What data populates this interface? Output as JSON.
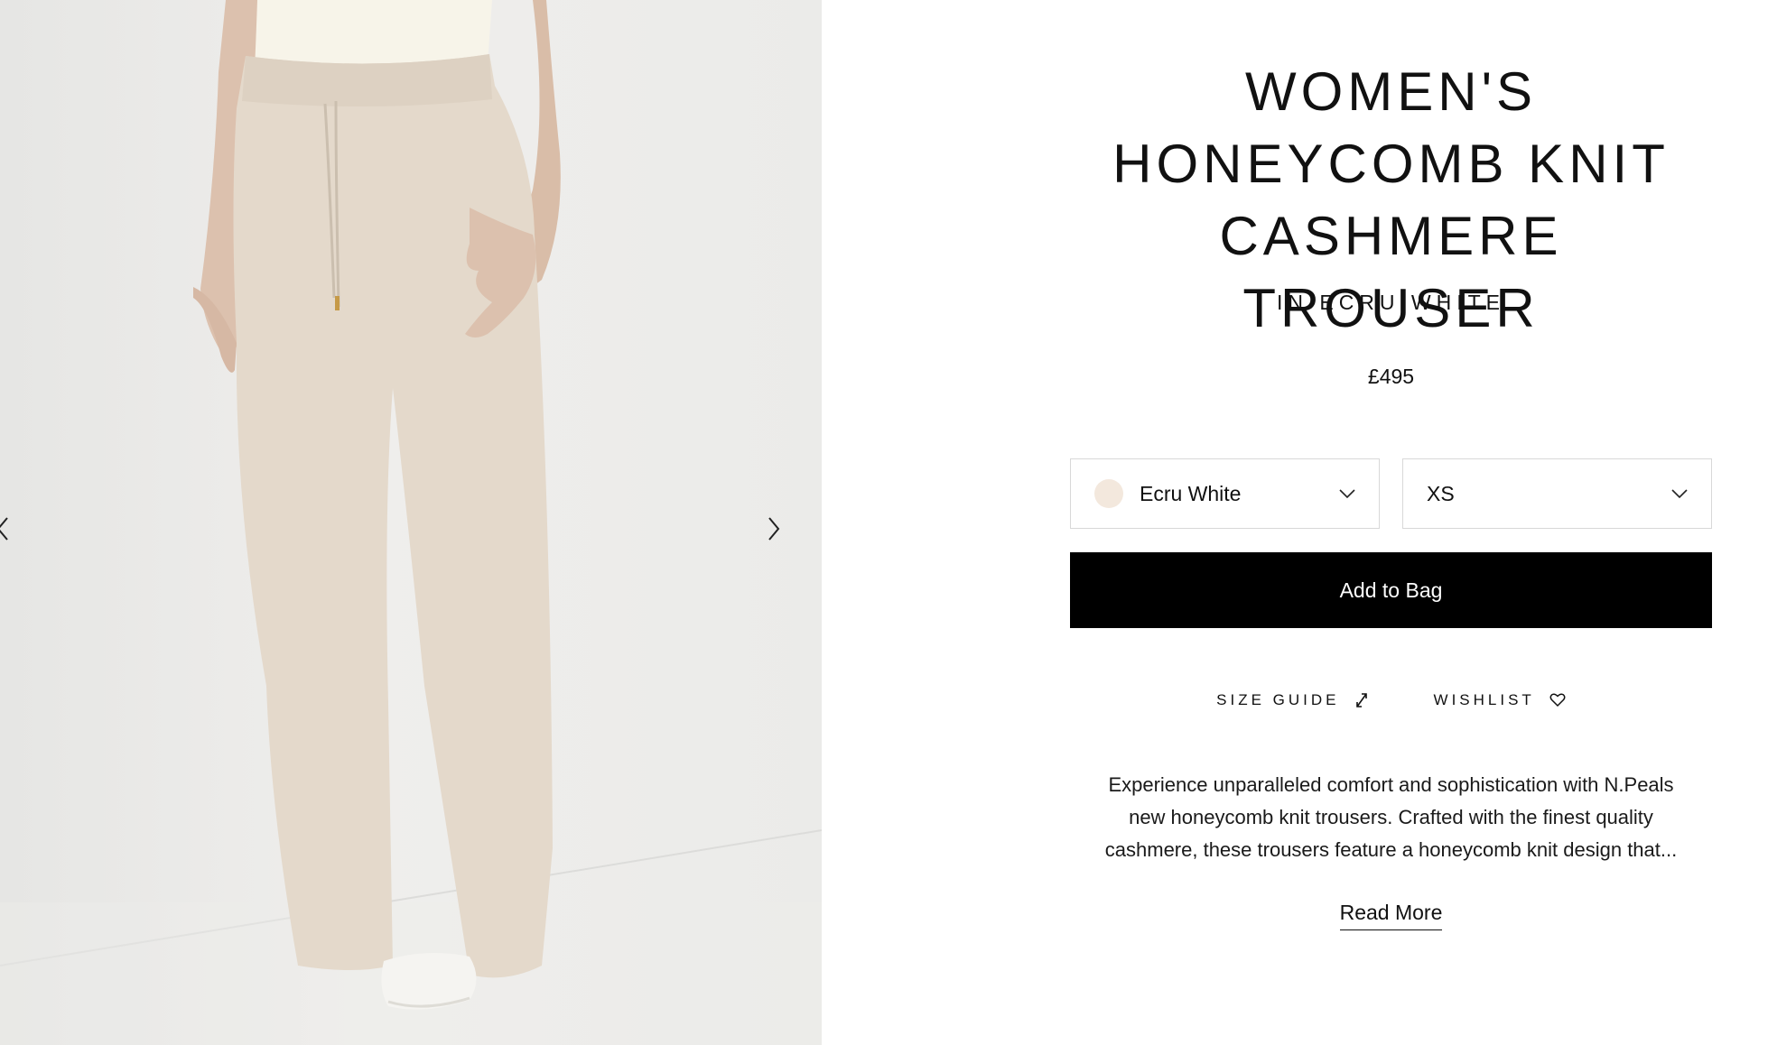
{
  "gallery": {
    "image_alt": "Model wearing wide leg honeycomb knit cashmere trousers in ecru white",
    "prev_icon": "chevron-left-icon",
    "next_icon": "chevron-right-icon"
  },
  "product": {
    "title_line1": "WOMEN'S",
    "title_line2": "HONEYCOMB KNIT",
    "title_line3": "CASHMERE TROUSER",
    "subtitle": "IN ECRU WHITE",
    "price": "£495"
  },
  "options": {
    "colour": {
      "label": "Ecru White",
      "swatch_color": "#f3e8dd"
    },
    "size": {
      "label": "XS"
    }
  },
  "actions": {
    "add_to_bag": "Add to Bag",
    "size_guide": "SIZE GUIDE",
    "wishlist": "WISHLIST"
  },
  "description": {
    "text": "Experience unparalleled comfort and sophistication with N.Peals new honeycomb knit trousers. Crafted with the finest quality cashmere, these trousers feature a honeycomb knit design that...",
    "read_more": "Read More"
  },
  "colors": {
    "button_bg": "#000000",
    "trouser": "#e4d9cb"
  }
}
